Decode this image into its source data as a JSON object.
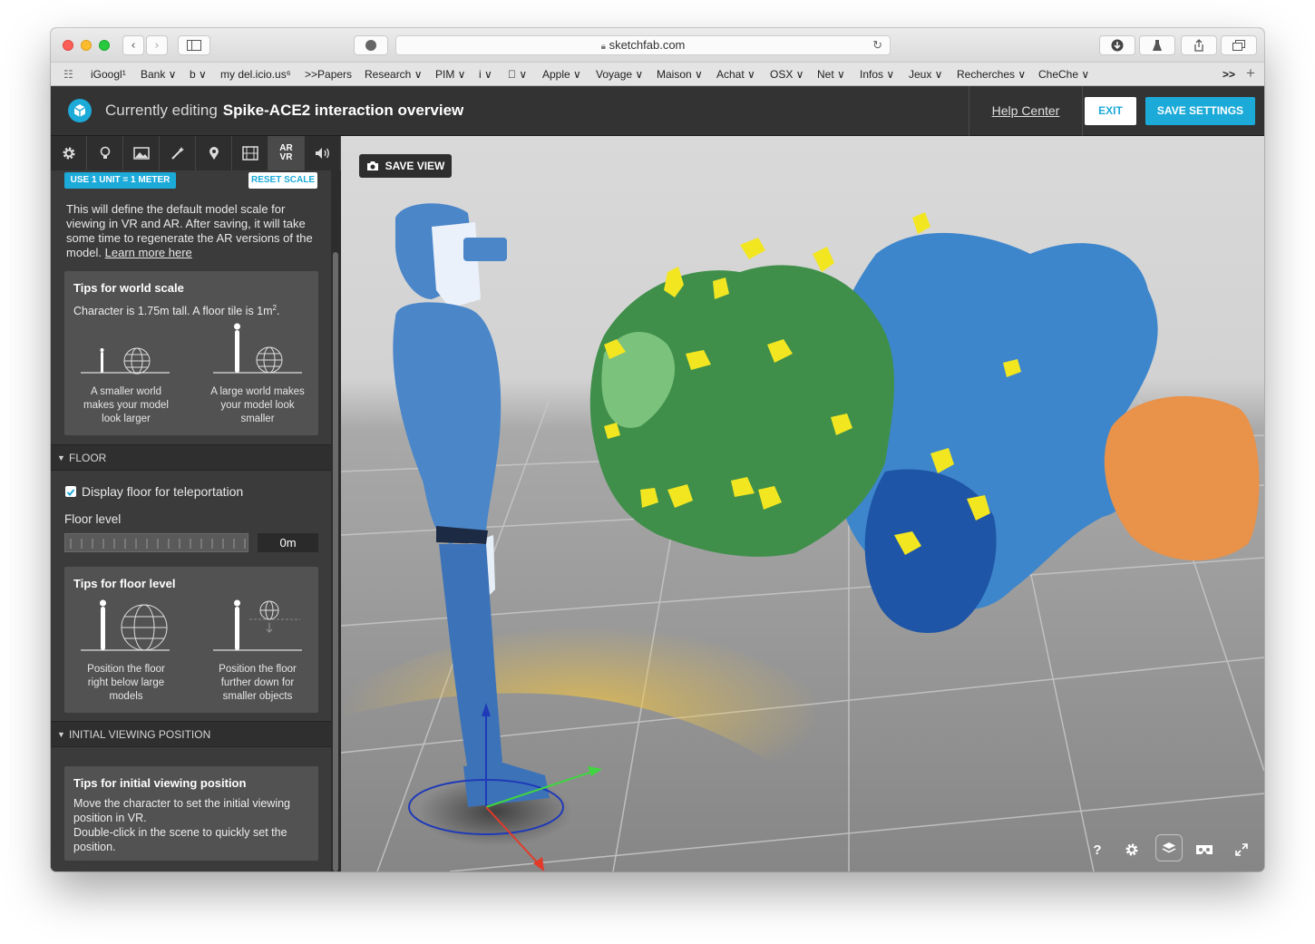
{
  "browser": {
    "url": "sketchfab.com",
    "bookmarks": [
      "iGoogl¹",
      "Bank ∨",
      "b ∨",
      "my del.icio.us⁶",
      ">>Papers",
      "Research ∨",
      "PIM ∨",
      "i ∨",
      " ∨",
      "Apple ∨",
      "Voyage ∨",
      "Maison ∨",
      "Achat ∨",
      "OSX ∨",
      "Net ∨",
      "Infos ∨",
      "Jeux ∨",
      "Recherches ∨",
      "CheChe ∨"
    ],
    "overflow": ">>"
  },
  "header": {
    "editing_label": "Currently editing",
    "model_title": "Spike-ACE2 interaction overview",
    "help_label": "Help Center",
    "exit_label": "EXIT",
    "save_label": "SAVE SETTINGS"
  },
  "tabs": [
    "settings",
    "lighting",
    "background",
    "post-processing",
    "annotations",
    "animation",
    "ar-vr",
    "sound"
  ],
  "tab_ar_label_top": "AR",
  "tab_ar_label_bottom": "VR",
  "scale": {
    "use_meter_label": "USE 1 UNIT = 1 METER",
    "reset_label": "RESET SCALE",
    "description": "This will define the default model scale for viewing in VR and AR. After saving, it will take some time to regenerate the AR versions of the model.",
    "learn_more": "Learn more here"
  },
  "world_scale_tips": {
    "title": "Tips for world scale",
    "text": "Character is 1.75m tall. A floor tile is 1m",
    "superscript": "2",
    "text_end": ".",
    "caption_left": "A smaller world makes your model look larger",
    "caption_right": "A large world makes your model look smaller"
  },
  "floor": {
    "section_label": "FLOOR",
    "checkbox_label": "Display floor for teleportation",
    "checkbox_checked": true,
    "level_label": "Floor level",
    "level_value": "0m"
  },
  "floor_tips": {
    "title": "Tips for floor level",
    "caption_left": "Position the floor right below large models",
    "caption_right": "Position the floor further down for smaller objects"
  },
  "initial_position": {
    "section_label": "INITIAL VIEWING POSITION",
    "tips_title": "Tips for initial viewing position",
    "tips_text": "Move the character to set the initial viewing position in VR.",
    "tips_text2": "Double-click in the scene to quickly set the position."
  },
  "viewport": {
    "save_view_label": "SAVE VIEW",
    "help_icon_label": "?"
  },
  "colors": {
    "accent": "#1caad9",
    "protein_green": "#3f8f4a",
    "protein_blue": "#3d86cc",
    "protein_darkblue": "#1f55a6",
    "protein_orange": "#e8924a",
    "glycan_yellow": "#f2e621"
  }
}
